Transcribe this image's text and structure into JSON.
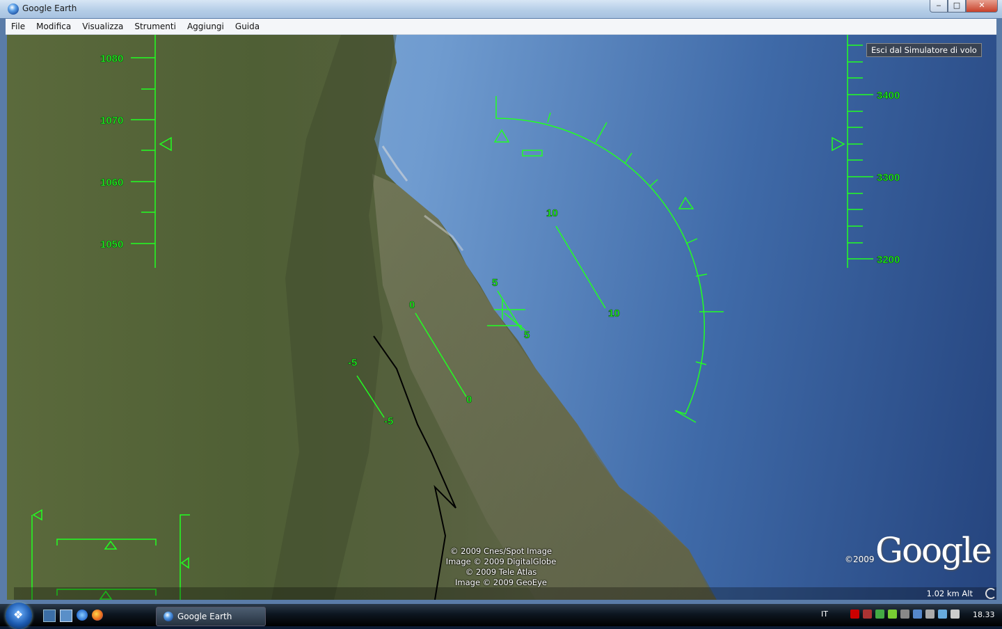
{
  "window": {
    "title": "Google Earth",
    "controls": {
      "minimize": "‒",
      "maximize": "□",
      "close": "✕"
    }
  },
  "menu": [
    "File",
    "Modifica",
    "Visualizza",
    "Strumenti",
    "Aggiungi",
    "Guida"
  ],
  "hud": {
    "exit_label": "Esci dal Simulatore di volo",
    "speed_labels": [
      "1080",
      "1070",
      "1060",
      "1050"
    ],
    "altitude_labels": [
      "3400",
      "3300",
      "3200"
    ],
    "pitch_labels": {
      "plus10_a": "10",
      "plus10_b": "10",
      "plus5_a": "5",
      "plus5_b": "5",
      "zero_a": "0",
      "zero_b": "0",
      "minus5_a": "-5",
      "minus5_b": "-5"
    },
    "color": "#22ff22"
  },
  "attribution": [
    "© 2009 Cnes/Spot Image",
    "Image © 2009 DigitalGlobe",
    "© 2009 Tele Atlas",
    "Image © 2009 GeoEye"
  ],
  "logo": {
    "year": "©2009",
    "text": "Google"
  },
  "status": {
    "altitude": "1.02 km Alt"
  },
  "taskbar": {
    "task_label": "Google Earth",
    "language": "IT",
    "clock": "18.33"
  }
}
